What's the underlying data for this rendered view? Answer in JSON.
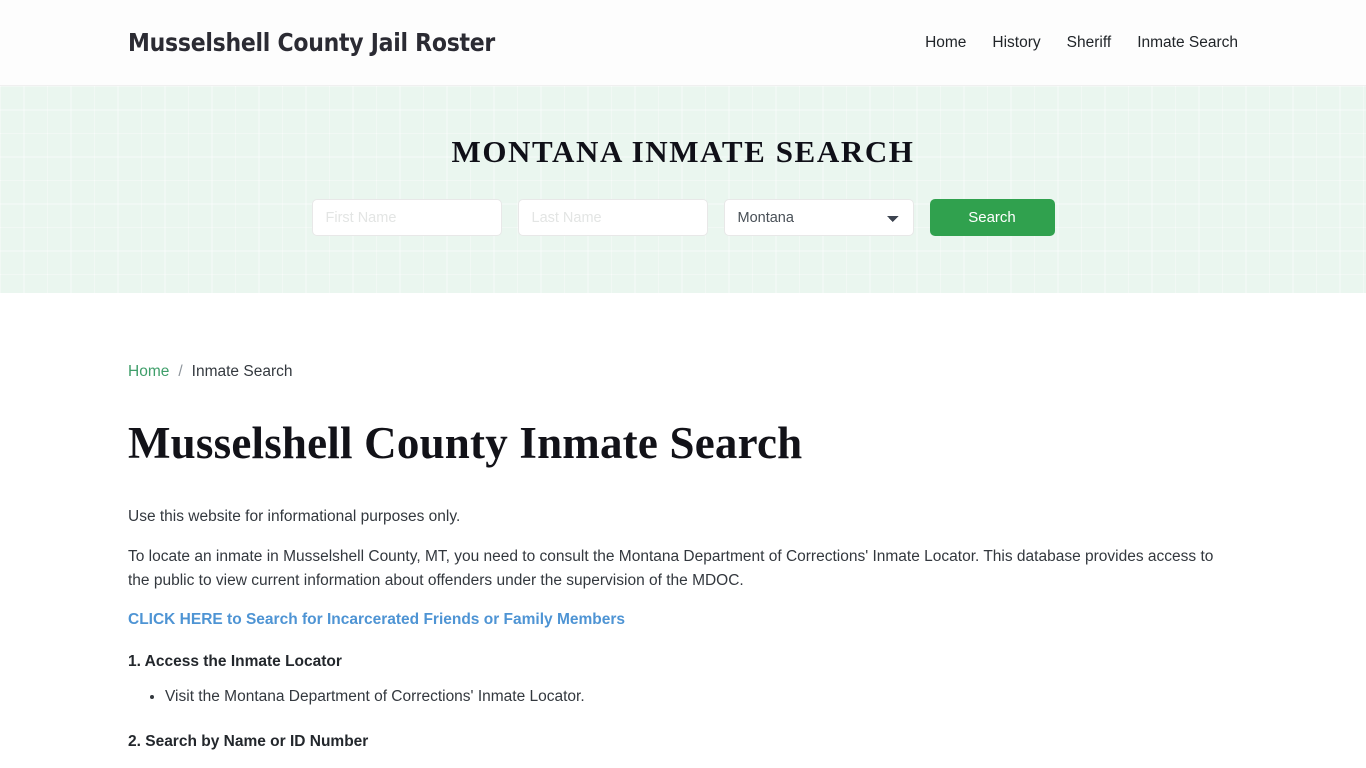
{
  "header": {
    "site_title": "Musselshell County Jail Roster",
    "nav": [
      {
        "label": "Home"
      },
      {
        "label": "History"
      },
      {
        "label": "Sheriff"
      },
      {
        "label": "Inmate Search"
      }
    ]
  },
  "hero": {
    "title": "MONTANA INMATE SEARCH",
    "form": {
      "first_name_placeholder": "First Name",
      "first_name_value": "",
      "last_name_placeholder": "Last Name",
      "last_name_value": "",
      "state_selected": "Montana",
      "state_options": [
        "Montana"
      ],
      "search_label": "Search"
    },
    "background_color": "#eaf6ef"
  },
  "breadcrumb": {
    "home_label": "Home",
    "separator": "/",
    "current_label": "Inmate Search"
  },
  "main": {
    "page_title": "Musselshell County Inmate Search",
    "paragraph_1": "Use this website for informational purposes only.",
    "paragraph_2": "To locate an inmate in Musselshell County, MT, you need to consult the Montana Department of Corrections' Inmate Locator. This database provides access to the public to view current information about offenders under the supervision of the MDOC.",
    "cta_link": "CLICK HERE to Search for Incarcerated Friends or Family Members",
    "step_1_heading": "1. Access the Inmate Locator",
    "step_1_bullet": "Visit the Montana Department of Corrections' Inmate Locator.",
    "step_2_heading": "2. Search by Name or ID Number"
  },
  "colors": {
    "accent_green": "#30a14e",
    "breadcrumb_green": "#3f9e6a",
    "link_blue": "#4e94d4"
  }
}
